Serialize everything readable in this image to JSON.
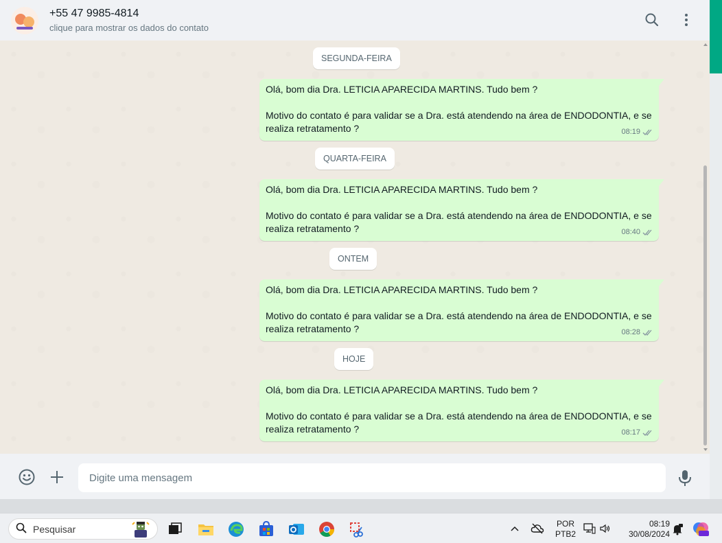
{
  "header": {
    "contact_name": "+55 47 9985-4814",
    "contact_sub": "clique para mostrar os dados do contato",
    "icons": [
      "search-icon",
      "menu-icon"
    ]
  },
  "chat": {
    "dates": [
      "SEGUNDA-FEIRA",
      "QUARTA-FEIRA",
      "ONTEM",
      "HOJE"
    ],
    "messages": [
      {
        "line1": "Olá, bom dia Dra. LETICIA APARECIDA MARTINS. Tudo bem ?",
        "line2": "Motivo do contato é para validar se a Dra. está atendendo na área de ENDODONTIA, e se",
        "line3": "realiza retratamento ?",
        "time": "08:19"
      },
      {
        "line1": "Olá, bom dia Dra. LETICIA APARECIDA MARTINS. Tudo bem ?",
        "line2": "Motivo do contato é para validar se a Dra. está atendendo na área de ENDODONTIA, e se",
        "line3": "realiza retratamento ?",
        "time": "08:40"
      },
      {
        "line1": "Olá, bom dia Dra. LETICIA APARECIDA MARTINS. Tudo bem ?",
        "line2": "Motivo do contato é para validar se a Dra. está atendendo na área de ENDODONTIA, e se",
        "line3": "realiza retratamento ?",
        "time": "08:28"
      },
      {
        "line1": "Olá, bom dia Dra. LETICIA APARECIDA MARTINS. Tudo bem ?",
        "line2": "Motivo do contato é para validar se a Dra. está atendendo na área de ENDODONTIA, e se",
        "line3": "realiza retratamento ?",
        "time": "08:17"
      }
    ]
  },
  "composer": {
    "placeholder": "Digite uma mensagem",
    "icons": [
      "emoji-icon",
      "attach-plus-icon",
      "microphone-icon"
    ]
  },
  "taskbar": {
    "search_label": "Pesquisar",
    "apps": [
      "task-view-icon",
      "file-explorer-icon",
      "edge-icon",
      "store-icon",
      "outlook-icon",
      "chrome-icon",
      "snipping-tool-icon"
    ],
    "lang_line1": "POR",
    "lang_line2": "PTB2",
    "time": "08:19",
    "date": "30/08/2024"
  },
  "colors": {
    "bubble_out": "#d9fdd3",
    "chat_bg": "#efeae2",
    "header_bg": "#f0f2f5",
    "accent": "#00a884",
    "read_ticks": "#8696a0"
  }
}
